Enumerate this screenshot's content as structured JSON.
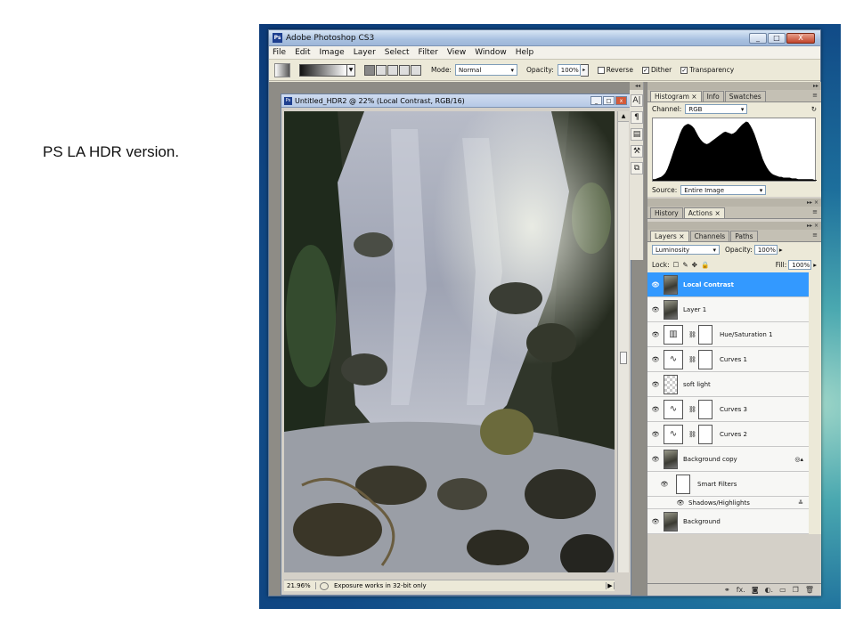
{
  "caption": "PS LA HDR version.",
  "window": {
    "title": "Adobe Photoshop CS3",
    "logo": "Ps",
    "min": "_",
    "max": "□",
    "close": "X"
  },
  "menu": [
    "File",
    "Edit",
    "Image",
    "Layer",
    "Select",
    "Filter",
    "View",
    "Window",
    "Help"
  ],
  "options": {
    "mode_label": "Mode:",
    "mode_value": "Normal",
    "opacity_label": "Opacity:",
    "opacity_value": "100%",
    "reverse_label": "Reverse",
    "dither_label": "Dither",
    "transparency_label": "Transparency",
    "reverse_checked": "",
    "dither_checked": "✓",
    "transparency_checked": "✓"
  },
  "document": {
    "logo": "Ps",
    "title": "Untitled_HDR2 @ 22% (Local Contrast, RGB/16)",
    "zoom": "21.96%",
    "status": "Exposure works in 32-bit only",
    "min": "_",
    "max": "□",
    "close": "x"
  },
  "histogram": {
    "tabs": [
      "Histogram ×",
      "Info",
      "Swatches"
    ],
    "channel_label": "Channel:",
    "channel_value": "RGB",
    "source_label": "Source:",
    "source_value": "Entire Image",
    "curve": [
      2,
      2,
      3,
      4,
      5,
      7,
      10,
      15,
      22,
      30,
      38,
      45,
      52,
      60,
      66,
      70,
      72,
      73,
      72,
      70,
      67,
      62,
      57,
      53,
      50,
      48,
      47,
      48,
      50,
      52,
      54,
      56,
      58,
      60,
      62,
      63,
      62,
      61,
      60,
      61,
      63,
      66,
      69,
      72,
      74,
      76,
      75,
      71,
      66,
      60,
      52,
      44,
      36,
      28,
      22,
      17,
      13,
      10,
      8,
      7,
      6,
      5,
      5,
      4,
      4,
      4,
      4,
      3,
      3,
      3,
      2,
      2,
      2,
      2,
      2,
      2,
      2,
      2,
      1,
      1
    ]
  },
  "history": {
    "tabs": [
      "History",
      "Actions ×"
    ]
  },
  "layers_panel": {
    "tabs": [
      "Layers ×",
      "Channels",
      "Paths"
    ],
    "blend_value": "Luminosity",
    "opacity_label": "Opacity:",
    "opacity_value": "100%",
    "lock_label": "Lock:",
    "fill_label": "Fill:",
    "fill_value": "100%",
    "layers": [
      {
        "name": "Local Contrast",
        "kind": "photo",
        "selected": true
      },
      {
        "name": "Layer 1",
        "kind": "photo"
      },
      {
        "name": "Hue/Saturation 1",
        "kind": "adj"
      },
      {
        "name": "Curves 1",
        "kind": "adj"
      },
      {
        "name": "soft light",
        "kind": "soft"
      },
      {
        "name": "Curves 3",
        "kind": "adj"
      },
      {
        "name": "Curves 2",
        "kind": "adj"
      },
      {
        "name": "Background copy",
        "kind": "photo"
      },
      {
        "name": "Smart Filters",
        "kind": "sub"
      },
      {
        "name": "Shadows/Highlights",
        "kind": "subtext"
      },
      {
        "name": "Background",
        "kind": "photo"
      }
    ]
  }
}
